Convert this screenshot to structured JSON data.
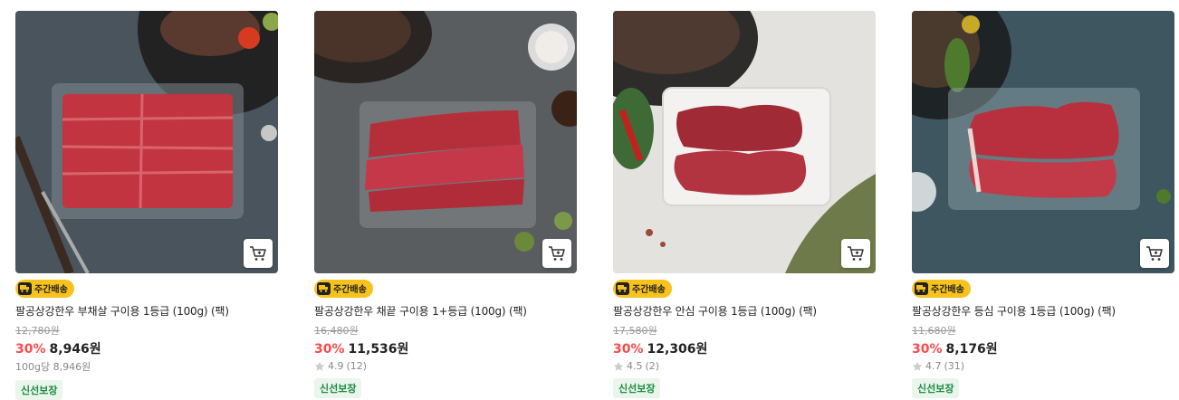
{
  "products": [
    {
      "badge": "주간배송",
      "title": "팔공상강한우 부채살 구이용 1등급 (100g) (팩)",
      "original_price": "12,780원",
      "discount": "30%",
      "price": "8,946원",
      "unit_price": "100g당 8,946원",
      "tag": "신선보장"
    },
    {
      "badge": "주간배송",
      "title": "팔공상강한우 채끝 구이용 1+등급 (100g) (팩)",
      "original_price": "16,480원",
      "discount": "30%",
      "price": "11,536원",
      "rating": "4.9",
      "reviews": "(12)",
      "tag": "신선보장"
    },
    {
      "badge": "주간배송",
      "title": "팔공상강한우 안심 구이용 1등급 (100g) (팩)",
      "original_price": "17,580원",
      "discount": "30%",
      "price": "12,306원",
      "rating": "4.5",
      "reviews": "(2)",
      "tag": "신선보장"
    },
    {
      "badge": "주간배송",
      "title": "팔공상강한우 등심 구이용 1등급 (100g) (팩)",
      "original_price": "11,680원",
      "discount": "30%",
      "price": "8,176원",
      "rating": "4.7",
      "reviews": "(31)",
      "tag": "신선보장"
    }
  ],
  "colors": {
    "discount": "#fa4b4b",
    "badge_bg": "#f8c21c",
    "fresh_tag_text": "#1f8a43",
    "fresh_tag_bg": "#eaf6ec"
  }
}
